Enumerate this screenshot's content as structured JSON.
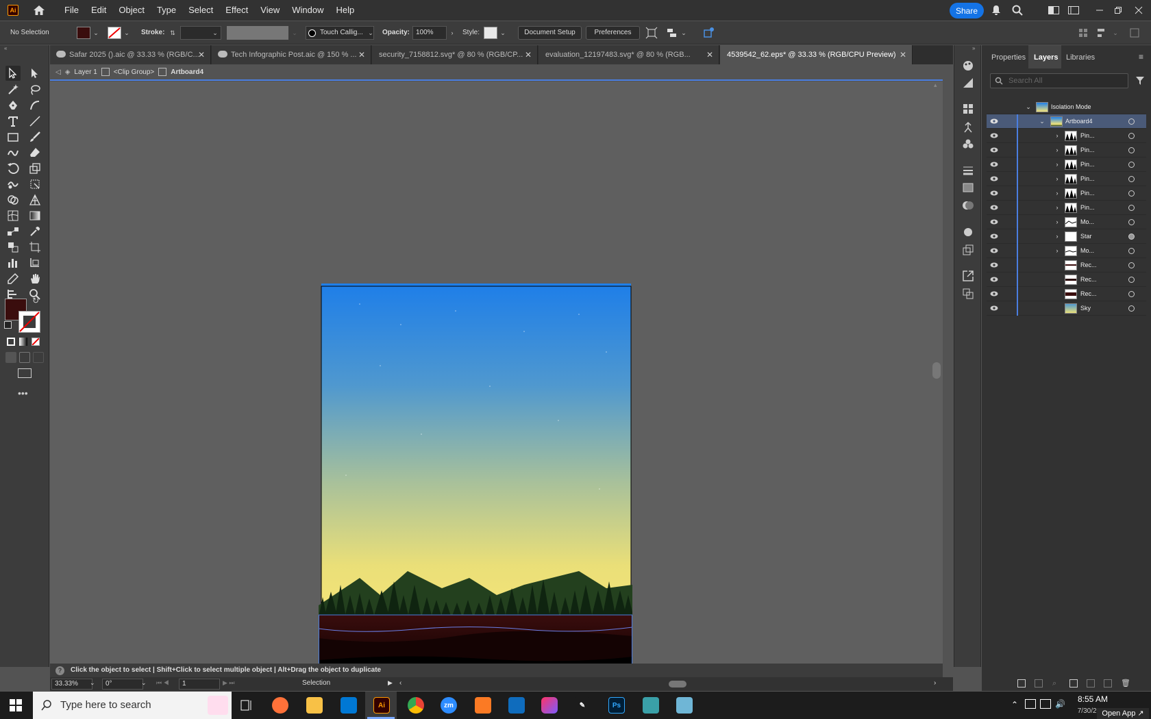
{
  "app": {
    "logo": "Ai"
  },
  "menu": [
    "File",
    "Edit",
    "Object",
    "Type",
    "Select",
    "Effect",
    "View",
    "Window",
    "Help"
  ],
  "share_label": "Share",
  "control": {
    "selection": "No Selection",
    "fill_color": "#3a0d0d",
    "stroke_label": "Stroke:",
    "brush": "Touch Callig...",
    "opacity_label": "Opacity:",
    "opacity_value": "100%",
    "style_label": "Style:",
    "document_setup": "Document Setup",
    "preferences": "Preferences"
  },
  "tabs": [
    {
      "label": "Safar 2025 ().aic @ 33.33 % (RGB/C..."
    },
    {
      "label": "Tech Infographic Post.aic @ 150 % ..."
    },
    {
      "label": "security_7158812.svg* @ 80 % (RGB/CP..."
    },
    {
      "label": "evaluation_12197483.svg* @ 80 % (RGB..."
    },
    {
      "label": "4539542_62.eps* @ 33.33 % (RGB/CPU Preview)"
    }
  ],
  "breadcrumb": {
    "layer": "Layer 1",
    "group": "<Clip Group>",
    "artboard": "Artboard4"
  },
  "panels": {
    "tabs": [
      "Properties",
      "Layers",
      "Libraries"
    ],
    "search_placeholder": "Search All",
    "isolation": "Isolation Mode",
    "artboard": "Artboard4",
    "layers": [
      {
        "name": "Pin..."
      },
      {
        "name": "Pin..."
      },
      {
        "name": "Pin..."
      },
      {
        "name": "Pin..."
      },
      {
        "name": "Pin..."
      },
      {
        "name": "Pin..."
      },
      {
        "name": "Mo..."
      },
      {
        "name": "Star"
      },
      {
        "name": "Mo..."
      },
      {
        "name": "Rec..."
      },
      {
        "name": "Rec..."
      },
      {
        "name": "Rec..."
      },
      {
        "name": "Sky"
      }
    ]
  },
  "hint": "Click the object to select  |  Shift+Click to select multiple object  |  Alt+Drag the object to duplicate",
  "status": {
    "zoom": "33.33%",
    "rotation": "0°",
    "artboard_num": "1",
    "tool": "Selection"
  },
  "taskbar": {
    "search_placeholder": "Type here to search",
    "time": "8:55 AM",
    "date": "7/30/2025",
    "open_app": "Open App"
  },
  "colors": {
    "accent": "#1473e6",
    "selection": "#4a7ee0",
    "fill": "#3a0d0d"
  }
}
